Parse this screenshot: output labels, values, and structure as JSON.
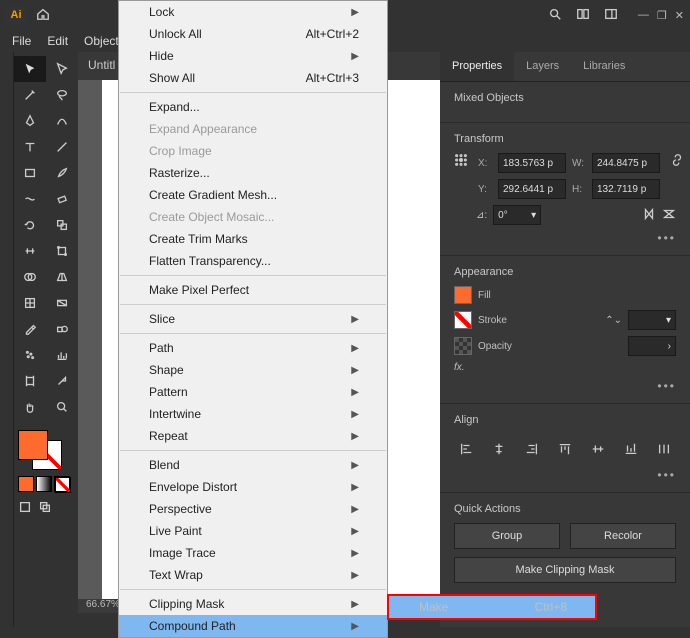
{
  "app": {
    "logo": "Ai"
  },
  "menubar": [
    "File",
    "Edit",
    "Object"
  ],
  "doc": {
    "tab": "Untitl",
    "zoom": "66.67%"
  },
  "obj_menu": [
    {
      "t": "item",
      "label": "Lock",
      "sub": true
    },
    {
      "t": "item",
      "label": "Unlock All",
      "kbd": "Alt+Ctrl+2"
    },
    {
      "t": "item",
      "label": "Hide",
      "sub": true
    },
    {
      "t": "item",
      "label": "Show All",
      "kbd": "Alt+Ctrl+3"
    },
    {
      "t": "sep"
    },
    {
      "t": "item",
      "label": "Expand..."
    },
    {
      "t": "item",
      "label": "Expand Appearance",
      "dis": true
    },
    {
      "t": "item",
      "label": "Crop Image",
      "dis": true
    },
    {
      "t": "item",
      "label": "Rasterize..."
    },
    {
      "t": "item",
      "label": "Create Gradient Mesh..."
    },
    {
      "t": "item",
      "label": "Create Object Mosaic...",
      "dis": true
    },
    {
      "t": "item",
      "label": "Create Trim Marks"
    },
    {
      "t": "item",
      "label": "Flatten Transparency..."
    },
    {
      "t": "sep"
    },
    {
      "t": "item",
      "label": "Make Pixel Perfect"
    },
    {
      "t": "sep"
    },
    {
      "t": "item",
      "label": "Slice",
      "sub": true
    },
    {
      "t": "sep"
    },
    {
      "t": "item",
      "label": "Path",
      "sub": true
    },
    {
      "t": "item",
      "label": "Shape",
      "sub": true
    },
    {
      "t": "item",
      "label": "Pattern",
      "sub": true
    },
    {
      "t": "item",
      "label": "Intertwine",
      "sub": true
    },
    {
      "t": "item",
      "label": "Repeat",
      "sub": true
    },
    {
      "t": "sep"
    },
    {
      "t": "item",
      "label": "Blend",
      "sub": true
    },
    {
      "t": "item",
      "label": "Envelope Distort",
      "sub": true
    },
    {
      "t": "item",
      "label": "Perspective",
      "sub": true
    },
    {
      "t": "item",
      "label": "Live Paint",
      "sub": true
    },
    {
      "t": "item",
      "label": "Image Trace",
      "sub": true
    },
    {
      "t": "item",
      "label": "Text Wrap",
      "sub": true
    },
    {
      "t": "sep"
    },
    {
      "t": "item",
      "label": "Clipping Mask",
      "sub": true
    },
    {
      "t": "item",
      "label": "Compound Path",
      "sub": true,
      "hl": true
    }
  ],
  "sub_menu": {
    "label": "Make",
    "kbd": "Ctrl+8"
  },
  "props": {
    "tabs": [
      "Properties",
      "Layers",
      "Libraries"
    ],
    "title": "Mixed Objects",
    "transform": {
      "h": "Transform",
      "x": "183.5763 p",
      "y": "292.6441 p",
      "w": "244.8475 p",
      "ht": "132.7119 p",
      "angle": "0°"
    },
    "appearance": {
      "h": "Appearance",
      "fill": "Fill",
      "fill_color": "#ff6b2c",
      "stroke": "Stroke",
      "opacity": "Opacity",
      "fx": "fx."
    },
    "align": {
      "h": "Align"
    },
    "quick": {
      "h": "Quick Actions",
      "group": "Group",
      "recolor": "Recolor",
      "clip": "Make Clipping Mask"
    }
  }
}
